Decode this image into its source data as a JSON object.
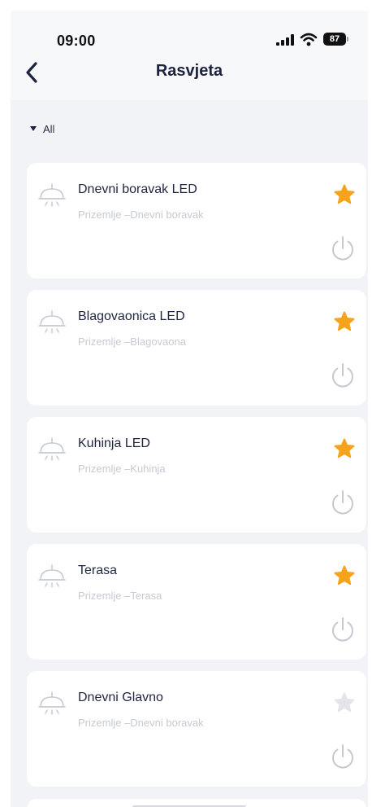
{
  "status_bar": {
    "time": "09:00",
    "battery": "87",
    "icons": [
      "signal-icon",
      "wifi-icon",
      "battery-icon"
    ]
  },
  "header": {
    "title": "Rasvjeta",
    "back_icon": "chevron-left-icon"
  },
  "filter": {
    "label": "All",
    "icon": "caret-down-icon"
  },
  "colors": {
    "accent_star": "#f7a21b",
    "star_inactive": "#e3e5ea",
    "icon_gray": "#c6c9d1",
    "text_primary": "#1f2540",
    "text_secondary": "#c7cad3",
    "background": "#f2f3f7"
  },
  "devices": [
    {
      "name": "Dnevni boravak LED",
      "location": "Prizemlje –Dnevni boravak",
      "favorite": true
    },
    {
      "name": "Blagovaonica LED",
      "location": "Prizemlje –Blagovaona",
      "favorite": true
    },
    {
      "name": "Kuhinja LED",
      "location": "Prizemlje –Kuhinja",
      "favorite": true
    },
    {
      "name": "Terasa",
      "location": "Prizemlje –Terasa",
      "favorite": true
    },
    {
      "name": "Dnevni Glavno",
      "location": "Prizemlje –Dnevni boravak",
      "favorite": false
    }
  ]
}
